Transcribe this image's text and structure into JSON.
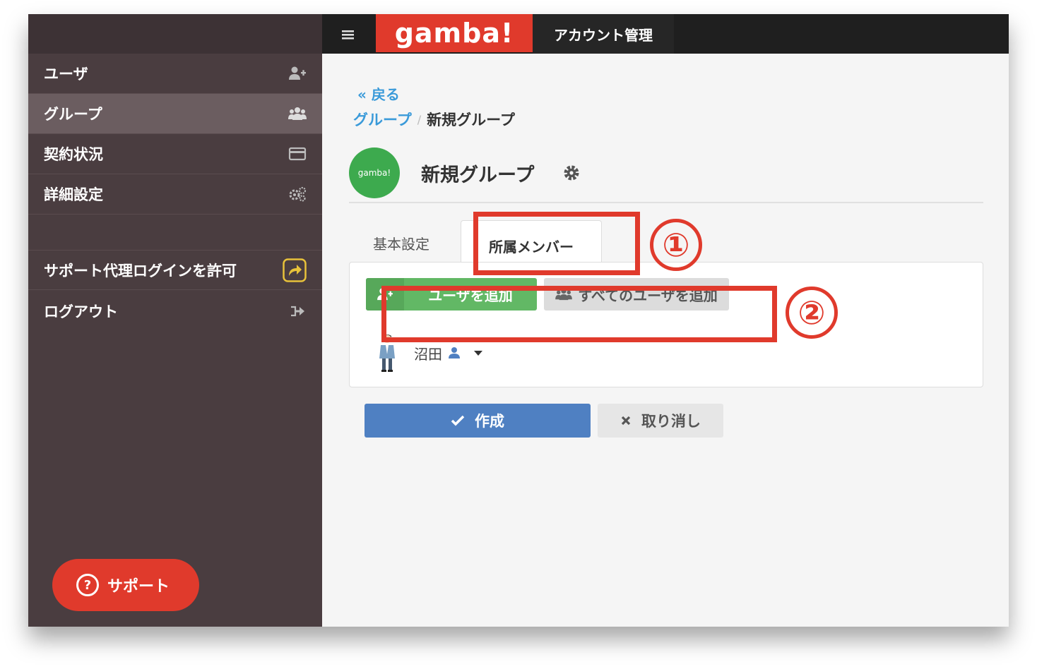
{
  "topbar": {
    "logo": "gamba!",
    "title": "アカウント管理"
  },
  "sidebar": {
    "items": [
      {
        "label": "ユーザ",
        "icon": "user-plus-icon"
      },
      {
        "label": "グループ",
        "icon": "group-icon"
      },
      {
        "label": "契約状況",
        "icon": "credit-card-icon"
      },
      {
        "label": "詳細設定",
        "icon": "gears-icon"
      },
      {
        "label": "サポート代理ログインを許可",
        "icon": "share-icon"
      },
      {
        "label": "ログアウト",
        "icon": "sign-out-icon"
      }
    ],
    "active_item": "グループ",
    "support_button": "サポート"
  },
  "main": {
    "back_label": "« 戻る",
    "breadcrumb": {
      "parent": "グループ",
      "separator": "/",
      "current": "新規グループ"
    },
    "avatar_text": "gamba!",
    "page_title": "新規グループ",
    "tabs": [
      {
        "label": "基本設定",
        "active": false
      },
      {
        "label": "所属メンバー",
        "active": true
      }
    ],
    "add_user_button": "ユーザを追加",
    "add_all_button": "すべてのユーザを追加",
    "members": [
      {
        "name": "沼田"
      }
    ],
    "create_button": "作成",
    "cancel_button": "取り消し"
  },
  "annotations": {
    "callout_1": "①",
    "callout_2": "②"
  },
  "colors": {
    "brand_red": "#e03a2c",
    "sidebar_bg": "#4a3d40",
    "link_blue": "#3a9ad9",
    "add_green": "#62b865",
    "create_blue": "#4f80c2"
  }
}
